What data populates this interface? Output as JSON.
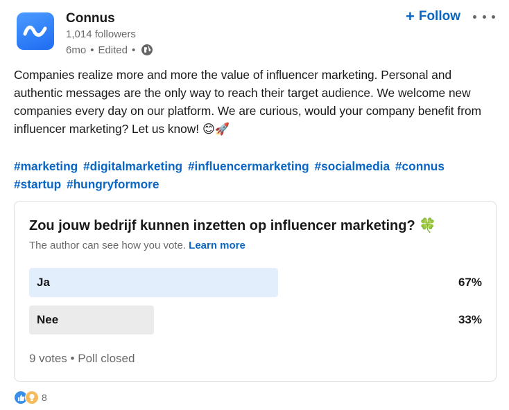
{
  "post": {
    "company": "Connus",
    "followers": "1,014 followers",
    "age": "6mo",
    "edited": "Edited",
    "follow_label": "Follow",
    "text": "Companies realize more and more the value of influencer marketing. Personal and authentic messages are the only way to reach their target audience. We welcome new companies every day on our platform. We are curious, would your company benefit from influencer marketing? Let us know! 😊🚀",
    "hashtags": [
      "#marketing",
      "#digitalmarketing",
      "#influencermarketing",
      "#socialmedia",
      "#connus",
      "#startup",
      "#hungryformore"
    ]
  },
  "poll": {
    "question": "Zou jouw bedrijf kunnen inzetten op influencer marketing? 🍀",
    "note": "The author can see how you vote.",
    "learn_more": "Learn more",
    "options": [
      {
        "label": "Ja",
        "percent": "67%",
        "fill": 0.55,
        "color": "#e2eefc"
      },
      {
        "label": "Nee",
        "percent": "33%",
        "fill": 0.275,
        "color": "#ebebeb"
      }
    ],
    "votes": "9 votes",
    "status": "Poll closed"
  },
  "reactions": {
    "count": "8",
    "icons": [
      "like-icon",
      "insightful-icon"
    ]
  },
  "colors": {
    "link": "#0a66c2",
    "logo": "#2b7bf5"
  }
}
